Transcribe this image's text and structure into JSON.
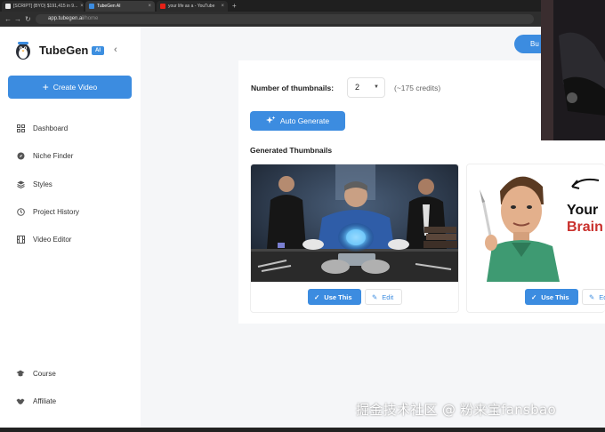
{
  "browser": {
    "tabs": [
      {
        "title": "[SCRIPT] (BYO) $191,415 in 9..."
      },
      {
        "title": "TubeGen AI"
      },
      {
        "title": "your life as a - YouTube"
      }
    ],
    "new_tab": "+",
    "url_host": "app.tubegen.ai",
    "url_path": "/home"
  },
  "sidebar": {
    "brand": "TubeGen",
    "badge": "AI",
    "collapse": "‹",
    "create_video": "Create Video",
    "nav": [
      {
        "label": "Dashboard",
        "icon": "grid-icon"
      },
      {
        "label": "Niche Finder",
        "icon": "compass-icon"
      },
      {
        "label": "Styles",
        "icon": "layers-icon"
      },
      {
        "label": "Project History",
        "icon": "history-icon"
      },
      {
        "label": "Video Editor",
        "icon": "film-icon"
      }
    ],
    "footer": [
      {
        "label": "Course",
        "icon": "graduation-icon"
      },
      {
        "label": "Affiliate",
        "icon": "handshake-icon"
      }
    ]
  },
  "header": {
    "buy_label": "Bu"
  },
  "main": {
    "num_thumbnails_label": "Number of thumbnails:",
    "num_thumbnails_value": "2",
    "credits": "(~175 credits)",
    "auto_generate": "Auto Generate",
    "generated_title": "Generated Thumbnails",
    "thumbnails": [
      {
        "use_label": "Use This",
        "edit_label": "Edit"
      },
      {
        "use_label": "Use This",
        "edit_label": "Ed",
        "overlay_line1": "Your",
        "overlay_line2": "Brain"
      }
    ]
  },
  "watermark": "掘金技术社区 @ 粉来宝fansbao",
  "colors": {
    "accent": "#3c8ce0",
    "sidebar_bg": "#ffffff",
    "main_bg": "#f5f6f8",
    "brand_red": "#c9302c"
  }
}
